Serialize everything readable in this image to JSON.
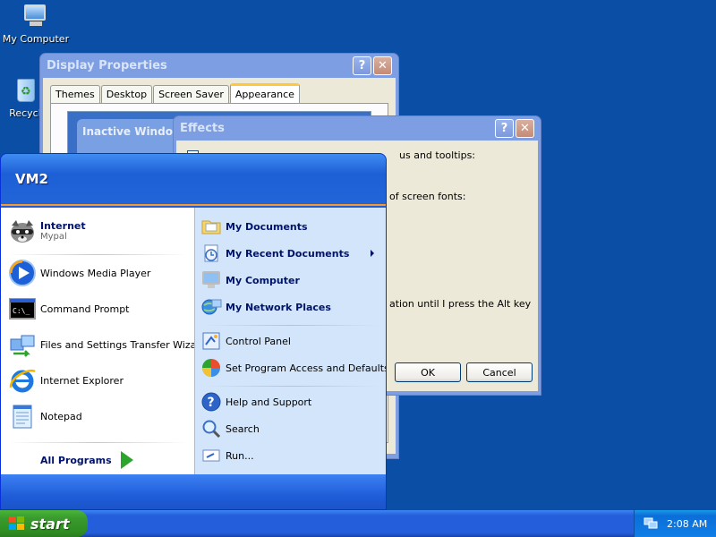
{
  "desktop": {
    "icons": [
      {
        "label": "My Computer",
        "icon": "my-computer-icon"
      },
      {
        "label": "Recycl",
        "icon": "recycle-bin-icon"
      }
    ]
  },
  "display_properties": {
    "title": "Display Properties",
    "tabs": [
      "Themes",
      "Desktop",
      "Screen Saver",
      "Appearance"
    ],
    "active_tab": "Appearance",
    "preview_inactive_window": "Inactive Window"
  },
  "effects_dialog": {
    "title": "Effects",
    "line1": "us and tooltips:",
    "line2": "of screen fonts:",
    "line3": "ation until I press the Alt key",
    "ok_label": "OK",
    "cancel_label": "Cancel"
  },
  "start_menu": {
    "user": "VM2",
    "left_pinned": [
      {
        "label": "Internet",
        "sub": "Mypal",
        "icon": "raccoon-browser-icon"
      }
    ],
    "left_recent": [
      {
        "label": "Windows Media Player",
        "icon": "media-player-icon"
      },
      {
        "label": "Command Prompt",
        "icon": "command-prompt-icon"
      },
      {
        "label": "Files and Settings Transfer Wizard",
        "icon": "transfer-wizard-icon"
      },
      {
        "label": "Internet Explorer",
        "icon": "internet-explorer-icon"
      },
      {
        "label": "Notepad",
        "icon": "notepad-icon"
      }
    ],
    "all_programs": "All Programs",
    "right_items": [
      {
        "label": "My Documents",
        "icon": "folder-icon"
      },
      {
        "label": "My Recent Documents",
        "icon": "recent-documents-icon"
      },
      {
        "label": "My Computer",
        "icon": "my-computer-icon"
      },
      {
        "label": "My Network Places",
        "icon": "network-places-icon"
      },
      {
        "label": "Control Panel",
        "icon": "control-panel-icon"
      },
      {
        "label": "Set Program Access and Defaults",
        "icon": "program-access-icon"
      },
      {
        "label": "Help and Support",
        "icon": "help-icon"
      },
      {
        "label": "Search",
        "icon": "search-icon"
      },
      {
        "label": "Run...",
        "icon": "run-icon"
      }
    ]
  },
  "taskbar": {
    "start_label": "start",
    "clock": "2:08 AM"
  },
  "colors": {
    "desktop": "#0a4ea6",
    "titlebar": "#0b4fd7",
    "start_button": "#3a9a2c",
    "menu_right": "#d3e5fa"
  }
}
